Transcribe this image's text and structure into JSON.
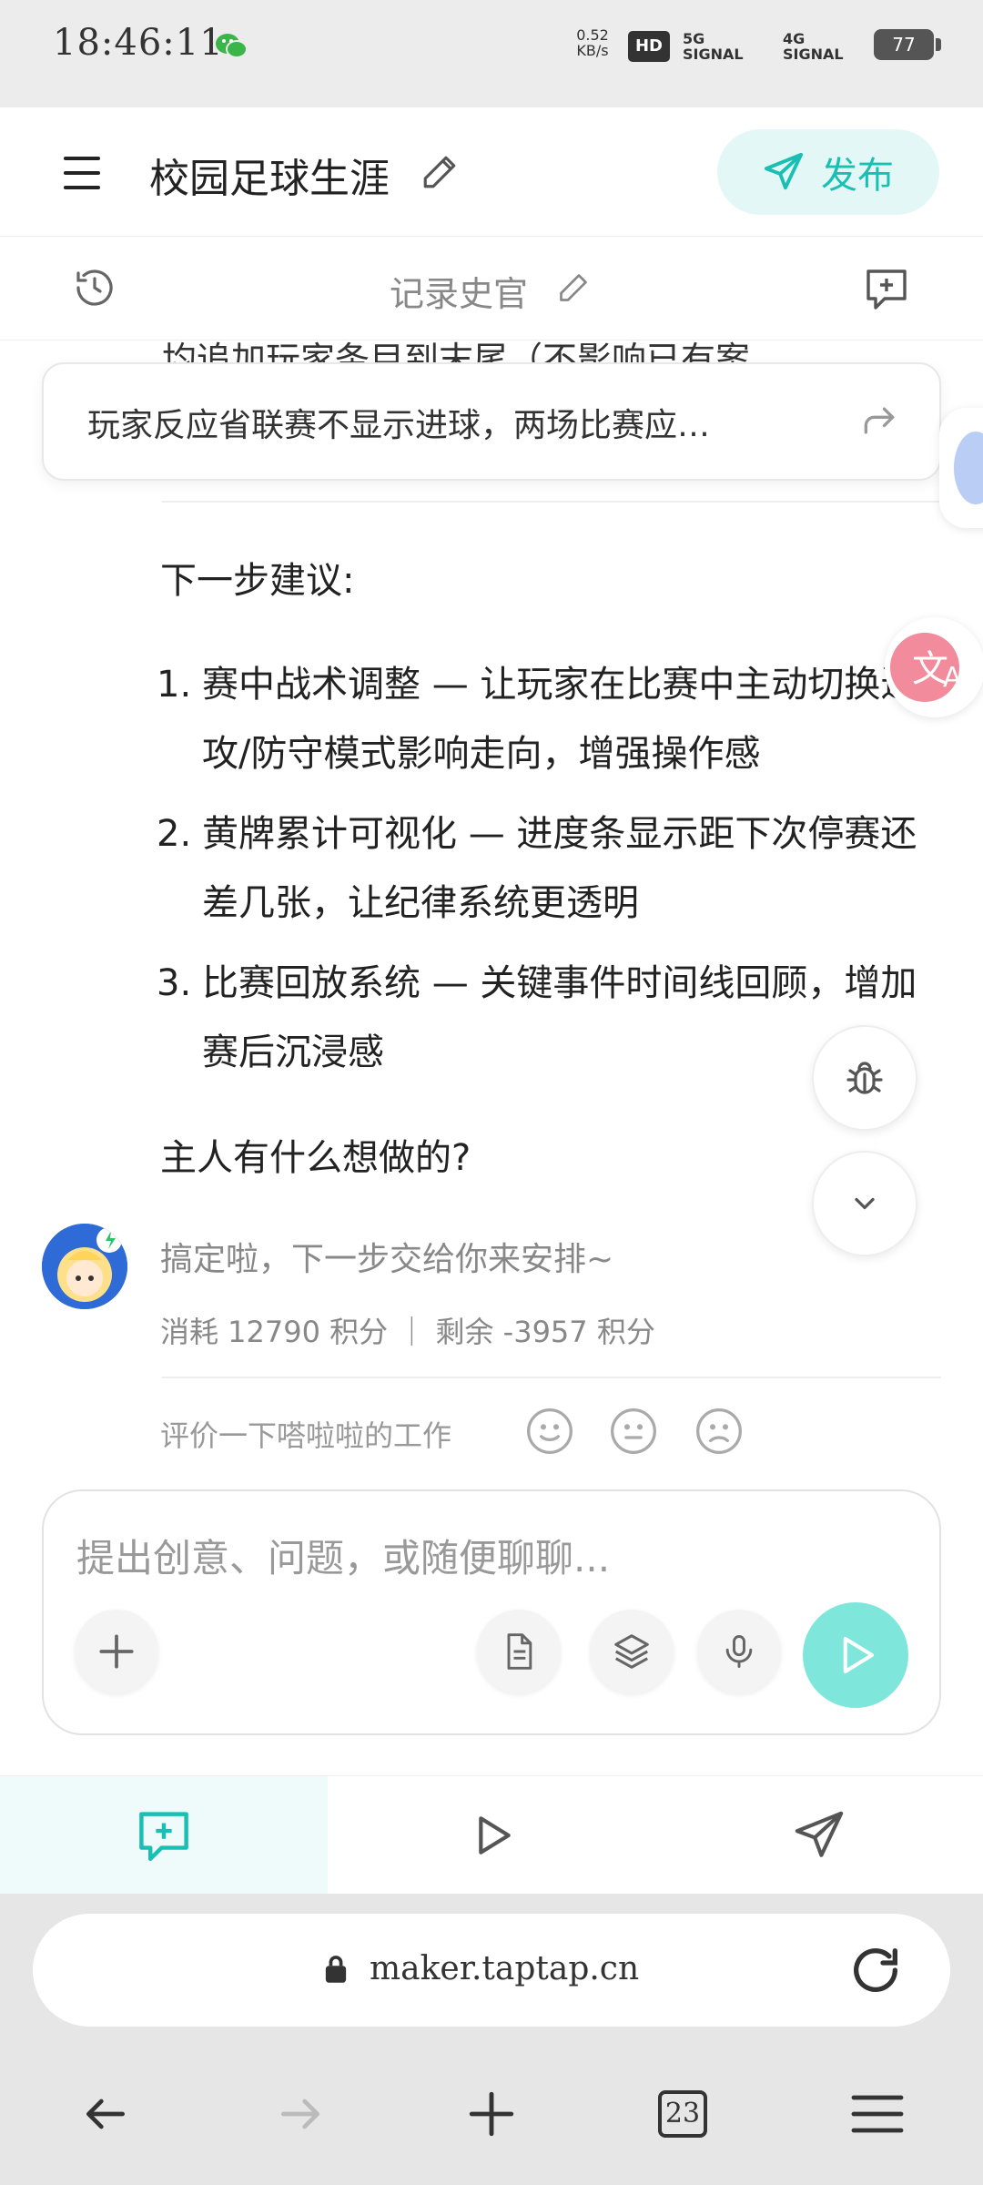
{
  "status_bar": {
    "time": "18:46:11",
    "network_speed": "0.52 KB/s",
    "hd": "HD",
    "signal1": "5G SIGNAL",
    "signal2": "4G SIGNAL",
    "battery": "77"
  },
  "header": {
    "title": "校园足球生涯",
    "publish_label": "发布"
  },
  "subheader": {
    "title": "记录史官"
  },
  "content": {
    "clipped_line": "均追加玩家条目到末尾（不影响已有案",
    "banner_text": "玩家反应省联赛不显示进球，两场比赛应…",
    "next_title": "下一步建议:",
    "items": [
      {
        "num": "1.",
        "text": "赛中战术调整 — 让玩家在比赛中主动切换进攻/防守模式影响走向，增强操作感"
      },
      {
        "num": "2.",
        "text": "黄牌累计可视化 — 进度条显示距下次停赛还差几张，让纪律系统更透明"
      },
      {
        "num": "3.",
        "text": "比赛回放系统 — 关键事件时间线回顾，增加赛后沉浸感"
      }
    ],
    "question": "主人有什么想做的?",
    "done_text": "搞定啦，下一步交给你来安排~",
    "usage": "消耗 12790 积分 ｜ 剩余 -3957 积分",
    "rate_label": "评价一下嗒啦啦的工作"
  },
  "input": {
    "placeholder": "提出创意、问题，或随便聊聊..."
  },
  "browser": {
    "url": "maker.taptap.cn",
    "tab_count": "23"
  },
  "colors": {
    "accent": "#18bfb2",
    "accent_light": "#e3f8f6",
    "send_button": "#7fe6dc"
  }
}
